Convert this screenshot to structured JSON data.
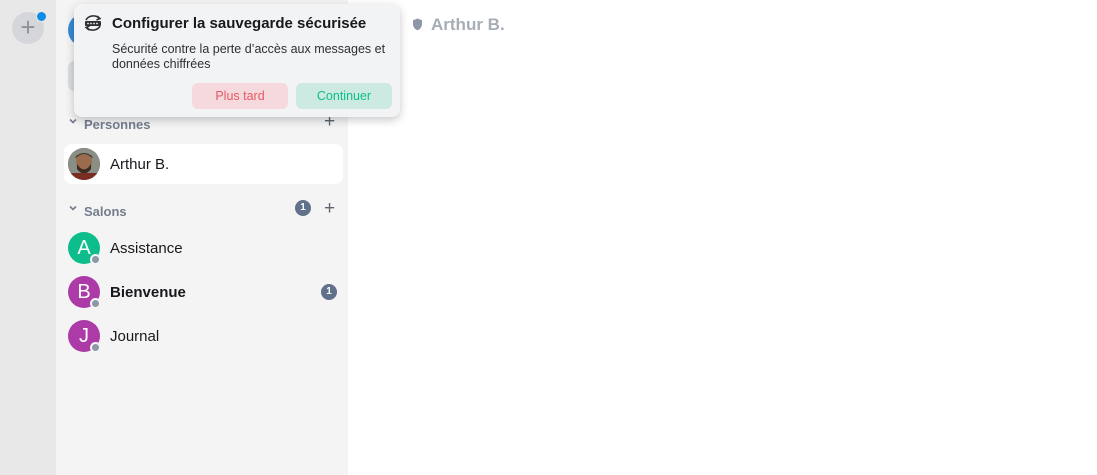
{
  "spaces": {
    "create_label": "+"
  },
  "header": {
    "room_name": "Arthur B."
  },
  "toast": {
    "title": "Configurer la sauvegarde sécurisée",
    "body": "Sécurité contre la perte d’accès aux messages et données chiffrées",
    "later_label": "Plus tard",
    "continue_label": "Continuer"
  },
  "sections": {
    "people": {
      "title": "Personnes",
      "add": "+"
    },
    "rooms": {
      "title": "Salons",
      "count": "1",
      "add": "+"
    }
  },
  "people": [
    {
      "name": "Arthur B."
    }
  ],
  "rooms": [
    {
      "initial": "A",
      "name": "Assistance",
      "color": "#0dbd8b"
    },
    {
      "initial": "B",
      "name": "Bienvenue",
      "color": "#ac3ba8",
      "unread": "1"
    },
    {
      "initial": "J",
      "name": "Journal",
      "color": "#ac3ba8"
    }
  ]
}
